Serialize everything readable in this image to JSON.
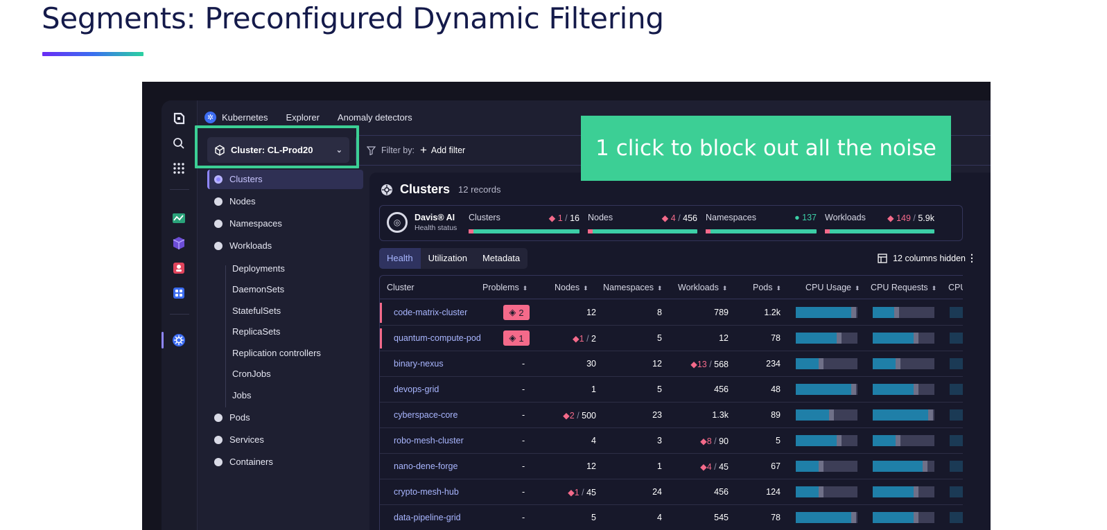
{
  "slide": {
    "title": "Segments: Preconfigured Dynamic Filtering",
    "callout": "1 click to block out all the noise"
  },
  "colors": {
    "accent_green": "#3ccf95",
    "problem_pink": "#f46a8a",
    "health_teal": "#3ccfa6",
    "link_purple": "#a9b6ff"
  },
  "topbar": {
    "app": "Kubernetes",
    "explorer": "Explorer",
    "anomaly": "Anomaly detectors"
  },
  "rail_icons": [
    "dynatrace-logo-icon",
    "search-icon",
    "apps-grid-icon",
    "app-green-icon",
    "app-purple-icon",
    "app-red-icon",
    "app-blue-icon",
    "kubernetes-icon"
  ],
  "segment": {
    "label": "Cluster: CL-Prod20"
  },
  "filter": {
    "label": "Filter by:",
    "add": "Add filter"
  },
  "nav": {
    "items": [
      "Clusters",
      "Nodes",
      "Namespaces",
      "Workloads"
    ],
    "workload_sub": [
      "Deployments",
      "DaemonSets",
      "StatefulSets",
      "ReplicaSets",
      "Replication controllers",
      "CronJobs",
      "Jobs"
    ],
    "bottom": [
      "Pods",
      "Services",
      "Containers"
    ]
  },
  "panel": {
    "title": "Clusters",
    "records": "12 records",
    "davis": {
      "title": "Davis® AI",
      "subtitle": "Health status"
    },
    "health": [
      {
        "label": "Clusters",
        "problems": "1",
        "sep": "/",
        "total": "16",
        "kind": "diamond"
      },
      {
        "label": "Nodes",
        "problems": "4",
        "sep": "/",
        "total": "456",
        "kind": "diamond"
      },
      {
        "label": "Namespaces",
        "problems": "137",
        "sep": "",
        "total": "",
        "kind": "dot"
      },
      {
        "label": "Workloads",
        "problems": "149",
        "sep": "/",
        "total": "5.9k",
        "kind": "diamond"
      }
    ],
    "tabs": [
      "Health",
      "Utilization",
      "Metadata"
    ],
    "active_tab": "Health",
    "columns_hidden": "12 columns hidden",
    "columns": [
      "Cluster",
      "Problems",
      "Nodes",
      "Namespaces",
      "Workloads",
      "Pods",
      "CPU Usage",
      "CPU Requests",
      "CPU"
    ],
    "rows": [
      {
        "cluster": "code-matrix-cluster",
        "problems": "2",
        "nodes_p": "",
        "nodes": "12",
        "namespaces": "8",
        "workloads_p": "",
        "workloads": "789",
        "pods": "1.2k",
        "cpu_usage": 0.9,
        "cpu_requests": 0.35,
        "flag": true
      },
      {
        "cluster": "quantum-compute-pod",
        "problems": "1",
        "nodes_p": "1",
        "nodes": "2",
        "namespaces": "5",
        "workloads_p": "",
        "workloads": "12",
        "pods": "78",
        "cpu_usage": 0.66,
        "cpu_requests": 0.66,
        "flag": true
      },
      {
        "cluster": "binary-nexus",
        "problems": "-",
        "nodes_p": "",
        "nodes": "30",
        "namespaces": "12",
        "workloads_p": "13",
        "workloads": "568",
        "pods": "234",
        "cpu_usage": 0.37,
        "cpu_requests": 0.37,
        "flag": false
      },
      {
        "cluster": "devops-grid",
        "problems": "-",
        "nodes_p": "",
        "nodes": "1",
        "namespaces": "5",
        "workloads_p": "",
        "workloads": "456",
        "pods": "48",
        "cpu_usage": 0.9,
        "cpu_requests": 0.66,
        "flag": false
      },
      {
        "cluster": "cyberspace-core",
        "problems": "-",
        "nodes_p": "2",
        "nodes": "500",
        "namespaces": "23",
        "workloads_p": "",
        "workloads": "1.3k",
        "pods": "89",
        "cpu_usage": 0.54,
        "cpu_requests": 0.9,
        "flag": false
      },
      {
        "cluster": "robo-mesh-cluster",
        "problems": "-",
        "nodes_p": "",
        "nodes": "4",
        "namespaces": "3",
        "workloads_p": "8",
        "workloads": "90",
        "pods": "5",
        "cpu_usage": 0.66,
        "cpu_requests": 0.37,
        "flag": false
      },
      {
        "cluster": "nano-dene-forge",
        "problems": "-",
        "nodes_p": "",
        "nodes": "12",
        "namespaces": "1",
        "workloads_p": "4",
        "workloads": "45",
        "pods": "67",
        "cpu_usage": 0.37,
        "cpu_requests": 0.81,
        "flag": false
      },
      {
        "cluster": "crypto-mesh-hub",
        "problems": "-",
        "nodes_p": "1",
        "nodes": "45",
        "namespaces": "24",
        "workloads_p": "",
        "workloads": "456",
        "pods": "124",
        "cpu_usage": 0.37,
        "cpu_requests": 0.66,
        "flag": false
      },
      {
        "cluster": "data-pipeline-grid",
        "problems": "-",
        "nodes_p": "",
        "nodes": "5",
        "namespaces": "4",
        "workloads_p": "",
        "workloads": "545",
        "pods": "78",
        "cpu_usage": 0.9,
        "cpu_requests": 0.66,
        "flag": false
      }
    ]
  }
}
